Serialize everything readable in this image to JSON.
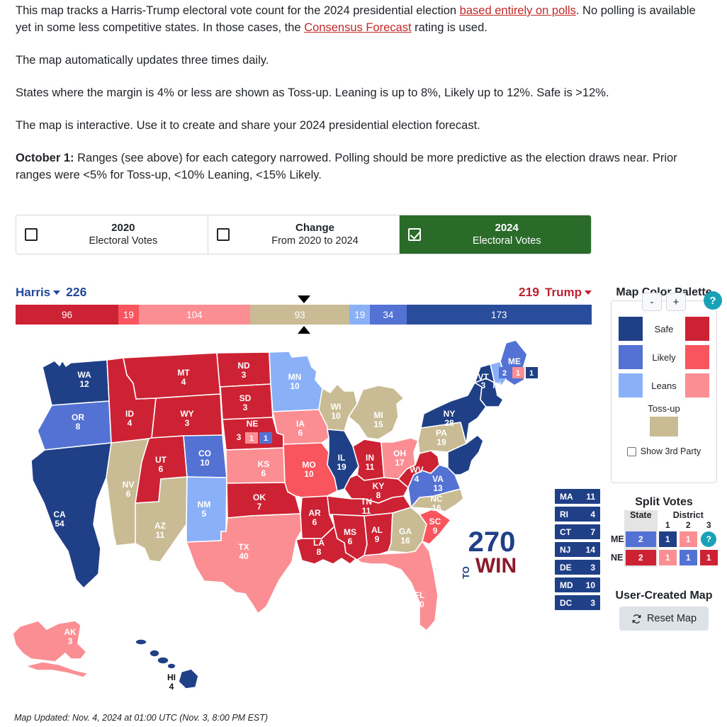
{
  "intro": {
    "p1_a": "This map tracks a Harris-Trump electoral vote count for the 2024 presidential election ",
    "p1_link1": "based entirely on polls",
    "p1_b": ". No polling is available yet in some less competitive states. In those cases, the ",
    "p1_link2": "Consensus Forecast",
    "p1_c": " rating is used.",
    "p2": "The map automatically updates three times daily.",
    "p3": "States where the margin is 4% or less are shown as Toss-up. Leaning is up to 8%, Likely up to 12%. Safe is >12%.",
    "p4": "The map is interactive. Use it to create and share your 2024 presidential election forecast.",
    "p5_bold": "October 1:",
    "p5_rest": " Ranges (see above) for each category narrowed. Polling should be more predictive as the election draws near. Prior ranges were <5% for Toss-up, <10% Leaning, <15% Likely."
  },
  "tabs": [
    {
      "title": "2020",
      "subtitle": "Electoral Votes",
      "checked": false
    },
    {
      "title": "Change",
      "subtitle": "From 2020 to 2024",
      "checked": false
    },
    {
      "title": "2024",
      "subtitle": "Electoral Votes",
      "checked": true
    }
  ],
  "scoreboard": {
    "left_name": "Harris",
    "left_total": "226",
    "right_total": "219",
    "right_name": "Trump",
    "segments": [
      {
        "label": "173",
        "value": 173,
        "color": "#2a4d9b",
        "category": "Safe D"
      },
      {
        "label": "34",
        "value": 34,
        "color": "#5472d3",
        "category": "Likely D"
      },
      {
        "label": "19",
        "value": 19,
        "color": "#8ab0f7",
        "category": "Leans D"
      },
      {
        "label": "93",
        "value": 93,
        "color": "#c9bc95",
        "category": "Toss-up"
      },
      {
        "label": "104",
        "value": 104,
        "color": "#fa8e93",
        "category": "Leans R"
      },
      {
        "label": "19",
        "value": 19,
        "color": "#f9555f",
        "category": "Likely R"
      },
      {
        "label": "96",
        "value": 96,
        "color": "#cc2233",
        "category": "Safe R"
      }
    ]
  },
  "palette": {
    "title": "Map Color Palette",
    "minus_label": "-",
    "plus_label": "+",
    "help_label": "?",
    "rows": [
      {
        "label": "Safe",
        "dem": "#1f3f87",
        "rep": "#cc2233"
      },
      {
        "label": "Likely",
        "dem": "#5472d3",
        "rep": "#f9555f"
      },
      {
        "label": "Leans",
        "dem": "#8ab0f7",
        "rep": "#fa8e93"
      }
    ],
    "tossup_label": "Toss-up",
    "tossup_color": "#c9bc95",
    "third_party_label": "Show 3rd Party"
  },
  "split_votes": {
    "title": "Split Votes",
    "state_header": "State",
    "district_header": "District",
    "district_numbers": [
      "1",
      "2",
      "3"
    ],
    "rows": [
      {
        "state": "ME",
        "state_cell": {
          "value": "2",
          "color": "#5472d3"
        },
        "districts": [
          {
            "value": "1",
            "color": "#1f3f87"
          },
          {
            "value": "1",
            "color": "#fa8e93"
          },
          {
            "value": "?",
            "color": "#17a2b8",
            "is_help": true
          }
        ]
      },
      {
        "state": "NE",
        "state_cell": {
          "value": "2",
          "color": "#cc2233"
        },
        "districts": [
          {
            "value": "1",
            "color": "#fa8e93"
          },
          {
            "value": "1",
            "color": "#5472d3"
          },
          {
            "value": "1",
            "color": "#cc2233"
          }
        ]
      }
    ]
  },
  "user_map": {
    "title": "User-Created Map",
    "reset_label": "Reset Map",
    "reset_icon": "refresh-icon"
  },
  "side_boxes": [
    {
      "abbr": "MA",
      "ev": "11",
      "color": "#1f3f87"
    },
    {
      "abbr": "RI",
      "ev": "4",
      "color": "#1f3f87"
    },
    {
      "abbr": "CT",
      "ev": "7",
      "color": "#1f3f87"
    },
    {
      "abbr": "NJ",
      "ev": "14",
      "color": "#1f3f87"
    },
    {
      "abbr": "DE",
      "ev": "3",
      "color": "#1f3f87"
    },
    {
      "abbr": "MD",
      "ev": "10",
      "color": "#1f3f87"
    },
    {
      "abbr": "DC",
      "ev": "3",
      "color": "#1f3f87"
    }
  ],
  "logo": {
    "top": "270",
    "to": "TO",
    "win": "WIN"
  },
  "footer": "Map Updated: Nov. 4, 2024 at 01:00 UTC (Nov. 3, 8:00 PM EST)",
  "map_data": {
    "type": "choropleth-map",
    "title": "2024 Electoral Votes",
    "colors": {
      "safe_d": "#1f3f87",
      "likely_d": "#5472d3",
      "leans_d": "#8ab0f7",
      "tossup": "#c9bc95",
      "leans_r": "#fa8e93",
      "likely_r": "#f9555f",
      "safe_r": "#cc2233"
    },
    "states": [
      {
        "abbr": "WA",
        "ev": "12",
        "rating": "safe_d",
        "color": "#1f3f87"
      },
      {
        "abbr": "OR",
        "ev": "8",
        "rating": "likely_d",
        "color": "#5472d3"
      },
      {
        "abbr": "CA",
        "ev": "54",
        "rating": "safe_d",
        "color": "#1f3f87"
      },
      {
        "abbr": "NV",
        "ev": "6",
        "rating": "tossup",
        "color": "#c9bc95"
      },
      {
        "abbr": "ID",
        "ev": "4",
        "rating": "safe_r",
        "color": "#cc2233"
      },
      {
        "abbr": "MT",
        "ev": "4",
        "rating": "safe_r",
        "color": "#cc2233"
      },
      {
        "abbr": "WY",
        "ev": "3",
        "rating": "safe_r",
        "color": "#cc2233"
      },
      {
        "abbr": "UT",
        "ev": "6",
        "rating": "safe_r",
        "color": "#cc2233"
      },
      {
        "abbr": "AZ",
        "ev": "11",
        "rating": "tossup",
        "color": "#c9bc95"
      },
      {
        "abbr": "CO",
        "ev": "10",
        "rating": "likely_d",
        "color": "#5472d3"
      },
      {
        "abbr": "NM",
        "ev": "5",
        "rating": "leans_d",
        "color": "#8ab0f7"
      },
      {
        "abbr": "ND",
        "ev": "3",
        "rating": "safe_r",
        "color": "#cc2233"
      },
      {
        "abbr": "SD",
        "ev": "3",
        "rating": "safe_r",
        "color": "#cc2233"
      },
      {
        "abbr": "NE",
        "ev": "3",
        "rating": "safe_r",
        "color": "#cc2233"
      },
      {
        "abbr": "KS",
        "ev": "6",
        "rating": "leans_r",
        "color": "#fa8e93"
      },
      {
        "abbr": "OK",
        "ev": "7",
        "rating": "safe_r",
        "color": "#cc2233"
      },
      {
        "abbr": "TX",
        "ev": "40",
        "rating": "leans_r",
        "color": "#fa8e93"
      },
      {
        "abbr": "MN",
        "ev": "10",
        "rating": "leans_d",
        "color": "#8ab0f7"
      },
      {
        "abbr": "IA",
        "ev": "6",
        "rating": "leans_r",
        "color": "#fa8e93"
      },
      {
        "abbr": "MO",
        "ev": "10",
        "rating": "likely_r",
        "color": "#f9555f"
      },
      {
        "abbr": "AR",
        "ev": "6",
        "rating": "safe_r",
        "color": "#cc2233"
      },
      {
        "abbr": "LA",
        "ev": "8",
        "rating": "safe_r",
        "color": "#cc2233"
      },
      {
        "abbr": "WI",
        "ev": "10",
        "rating": "tossup",
        "color": "#c9bc95"
      },
      {
        "abbr": "IL",
        "ev": "19",
        "rating": "safe_d",
        "color": "#1f3f87"
      },
      {
        "abbr": "MI",
        "ev": "15",
        "rating": "tossup",
        "color": "#c9bc95"
      },
      {
        "abbr": "IN",
        "ev": "11",
        "rating": "safe_r",
        "color": "#cc2233"
      },
      {
        "abbr": "OH",
        "ev": "17",
        "rating": "leans_r",
        "color": "#fa8e93"
      },
      {
        "abbr": "KY",
        "ev": "8",
        "rating": "safe_r",
        "color": "#cc2233"
      },
      {
        "abbr": "TN",
        "ev": "11",
        "rating": "safe_r",
        "color": "#cc2233"
      },
      {
        "abbr": "MS",
        "ev": "6",
        "rating": "safe_r",
        "color": "#cc2233"
      },
      {
        "abbr": "AL",
        "ev": "9",
        "rating": "safe_r",
        "color": "#cc2233"
      },
      {
        "abbr": "GA",
        "ev": "16",
        "rating": "tossup",
        "color": "#c9bc95"
      },
      {
        "abbr": "FL",
        "ev": "30",
        "rating": "leans_r",
        "color": "#fa8e93"
      },
      {
        "abbr": "SC",
        "ev": "9",
        "rating": "likely_r",
        "color": "#f9555f"
      },
      {
        "abbr": "NC",
        "ev": "16",
        "rating": "tossup",
        "color": "#c9bc95"
      },
      {
        "abbr": "VA",
        "ev": "13",
        "rating": "likely_d",
        "color": "#5472d3"
      },
      {
        "abbr": "WV",
        "ev": "4",
        "rating": "safe_r",
        "color": "#cc2233"
      },
      {
        "abbr": "PA",
        "ev": "19",
        "rating": "tossup",
        "color": "#c9bc95"
      },
      {
        "abbr": "NY",
        "ev": "28",
        "rating": "safe_d",
        "color": "#1f3f87"
      },
      {
        "abbr": "VT",
        "ev": "3",
        "rating": "safe_d",
        "color": "#1f3f87"
      },
      {
        "abbr": "NH",
        "ev": "4",
        "rating": "leans_d",
        "color": "#8ab0f7"
      },
      {
        "abbr": "ME",
        "ev": "",
        "rating": "likely_d",
        "color": "#5472d3"
      },
      {
        "abbr": "AK",
        "ev": "3",
        "rating": "leans_r",
        "color": "#fa8e93"
      },
      {
        "abbr": "HI",
        "ev": "4",
        "rating": "safe_d",
        "color": "#1f3f87"
      }
    ],
    "map_splits": {
      "ME": {
        "state_ev": "2",
        "d1": "1",
        "d1_color": "#fa8e93",
        "d2": "1",
        "d2_color": "#1f3f87",
        "state_color": "#5472d3"
      },
      "NE": {
        "state_ev": "3",
        "d1": "1",
        "d1_color": "#fa8e93",
        "d2": "1",
        "d2_color": "#5472d3"
      }
    }
  }
}
